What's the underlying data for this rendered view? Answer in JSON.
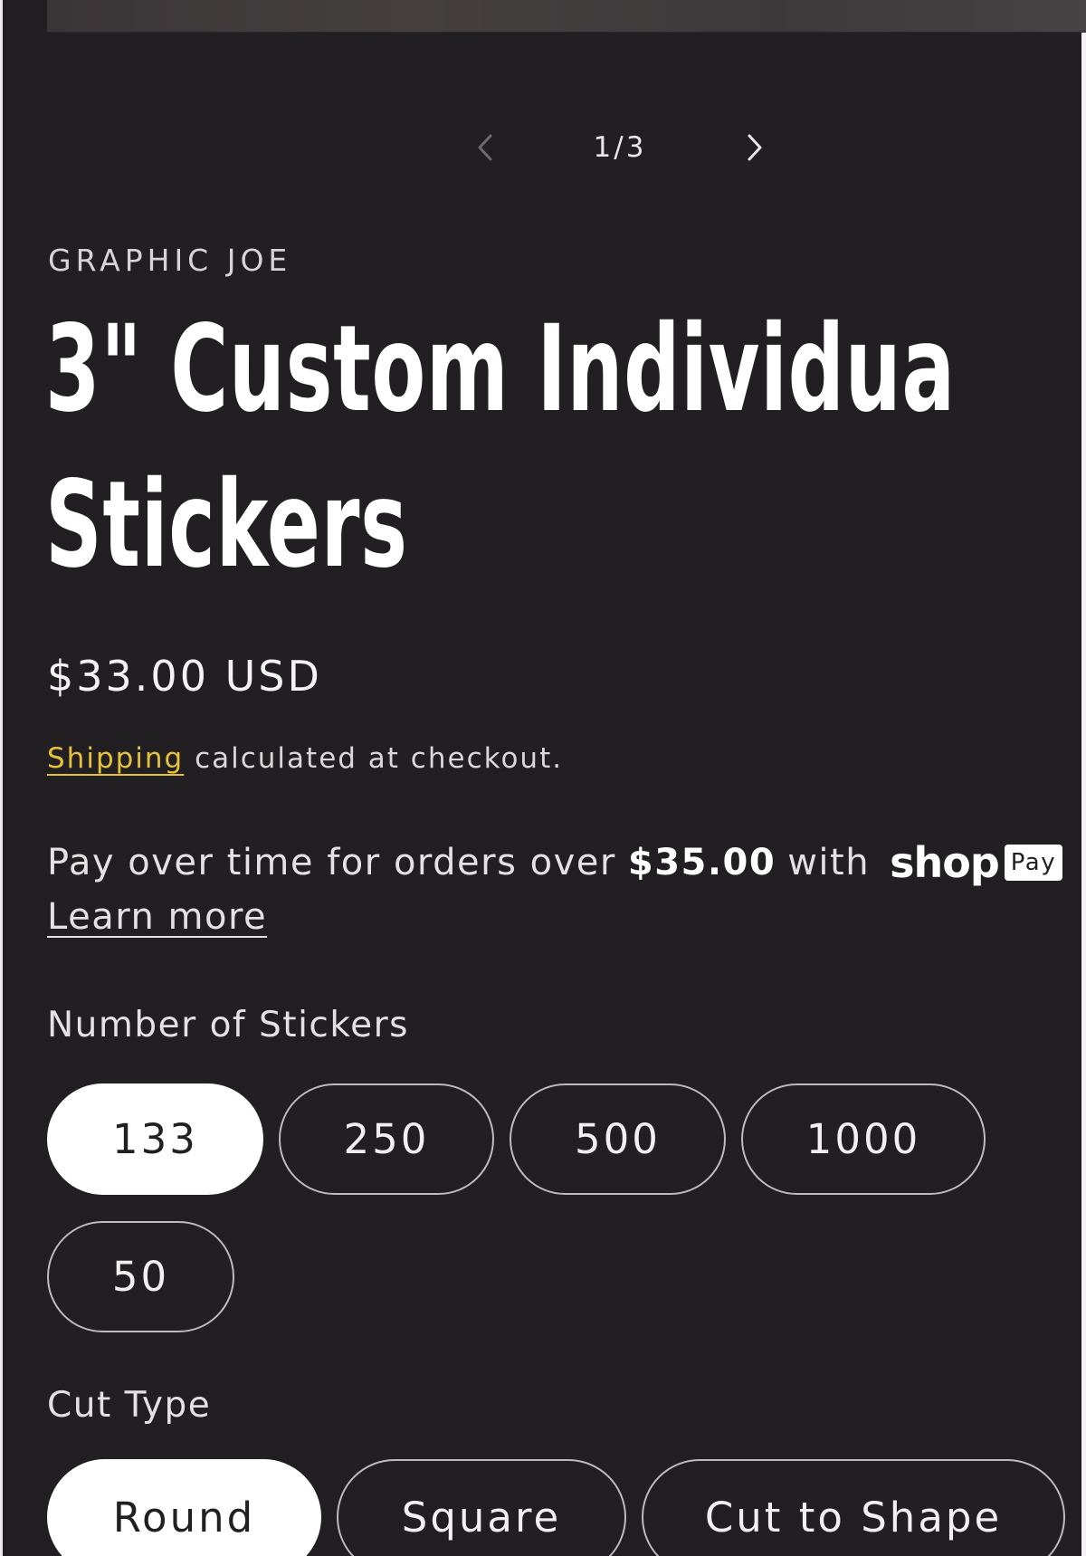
{
  "gallery": {
    "counter": "1/3",
    "prev_icon": "chevron-left-icon",
    "next_icon": "chevron-right-icon"
  },
  "product": {
    "vendor": "GRAPHIC JOE",
    "title_line1": "3\" Custom Individua",
    "title_line2": "Stickers",
    "price": "$33.00 USD"
  },
  "shipping": {
    "link": "Shipping",
    "text": " calculated at checkout."
  },
  "shop_pay": {
    "text_before": "Pay over time for orders over",
    "amount": "$35.00",
    "text_after": "with",
    "logo": "shop",
    "badge": "Pay",
    "learn_more": "Learn more"
  },
  "options": {
    "quantity": {
      "label": "Number of Stickers",
      "values": [
        "133",
        "250",
        "500",
        "1000",
        "50"
      ],
      "selected": "133"
    },
    "cut_type": {
      "label": "Cut Type",
      "values": [
        "Round",
        "Square",
        "Cut to Shape"
      ],
      "selected": "Round"
    }
  },
  "colors": {
    "background": "#221f22",
    "link_accent": "#e6c13c",
    "selected_pill": "#ffffff"
  }
}
